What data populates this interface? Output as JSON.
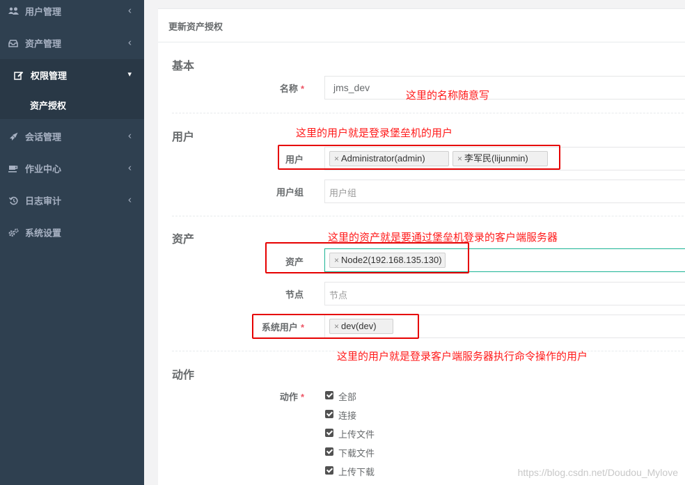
{
  "sidebar": {
    "items": [
      {
        "label": "用户管理",
        "icon": "users-icon"
      },
      {
        "label": "资产管理",
        "icon": "inbox-icon"
      },
      {
        "label": "权限管理",
        "icon": "edit-icon",
        "active": true
      },
      {
        "label": "会话管理",
        "icon": "rocket-icon"
      },
      {
        "label": "作业中心",
        "icon": "coffee-icon"
      },
      {
        "label": "日志审计",
        "icon": "history-icon"
      },
      {
        "label": "系统设置",
        "icon": "gears-icon"
      }
    ],
    "subitem": "资产授权"
  },
  "panel": {
    "title": "更新资产授权",
    "sections": {
      "basic": "基本",
      "user": "用户",
      "asset": "资产",
      "action": "动作"
    },
    "fields": {
      "name": {
        "label": "名称",
        "value": "jms_dev"
      },
      "users": {
        "label": "用户",
        "tags": [
          "Administrator(admin)",
          "李军民(lijunmin)"
        ]
      },
      "user_groups": {
        "label": "用户组",
        "placeholder": "用户组"
      },
      "assets": {
        "label": "资产",
        "tags": [
          "Node2(192.168.135.130)"
        ]
      },
      "nodes": {
        "label": "节点",
        "placeholder": "节点"
      },
      "system_users": {
        "label": "系统用户",
        "tags": [
          "dev(dev)"
        ]
      },
      "actions": {
        "label": "动作",
        "options": [
          "全部",
          "连接",
          "上传文件",
          "下载文件",
          "上传下载"
        ]
      }
    },
    "required_mark": "*",
    "tag_remove": "×"
  },
  "annotations": {
    "name_note": "这里的名称随意写",
    "user_note": "这里的用户就是登录堡垒机的用户",
    "asset_note": "这里的资产就是要通过堡垒机登录的客户端服务器",
    "sysuser_note": "这里的用户就是登录客户端服务器执行命令操作的用户"
  },
  "watermark": "https://blog.csdn.net/Doudou_Mylove",
  "colors": {
    "sidebar": "#2f4050",
    "accent": "#1ab394",
    "annotation": "#ff1a1a",
    "required": "#ed5565"
  }
}
